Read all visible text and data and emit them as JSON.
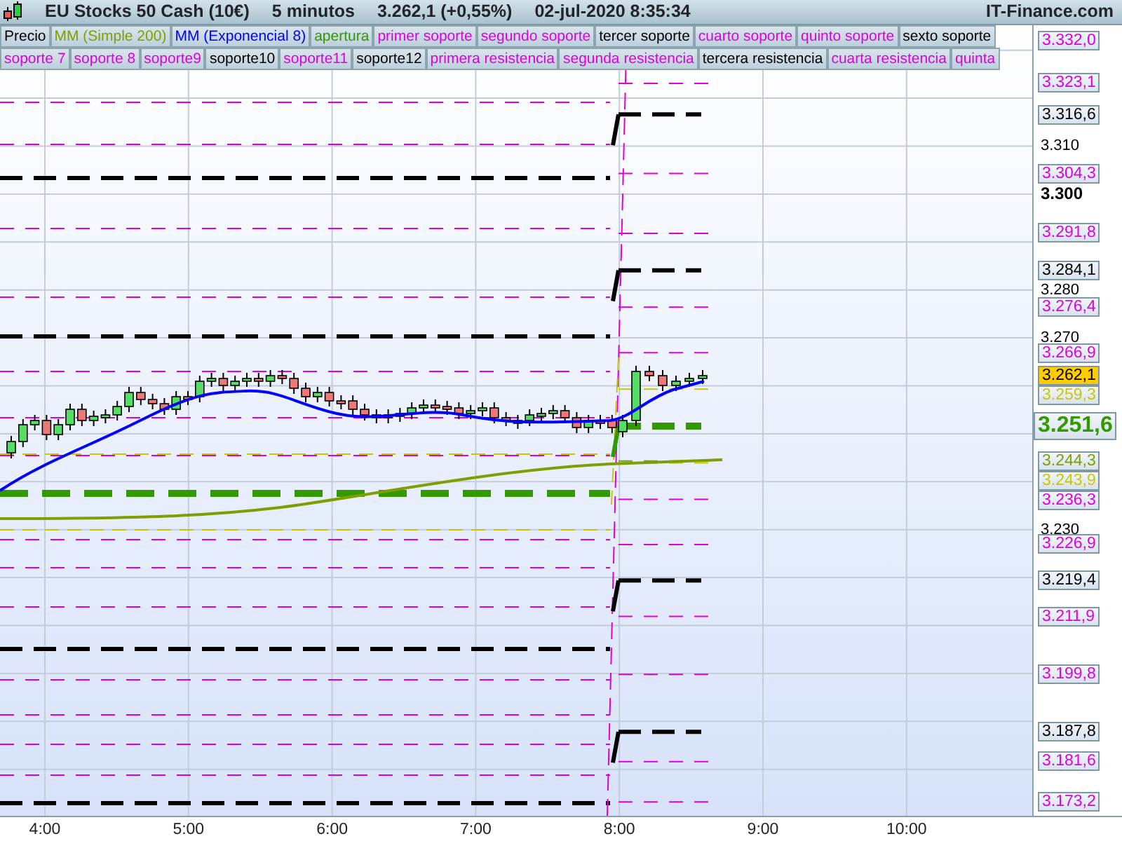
{
  "header": {
    "instrument": "EU Stocks 50 Cash (10€)",
    "timeframe": "5 minutos",
    "price": "3.262,1 (+0,55%)",
    "datetime": "02-jul-2020 8:35:34",
    "site": "IT-Finance.com"
  },
  "legend_rows": [
    {
      "items": [
        {
          "label": "Precio",
          "color": "#000000"
        },
        {
          "label": "MM (Simple 200)",
          "color": "#7f9f00"
        },
        {
          "label": "MM (Exponencial 8)",
          "color": "#0000ff"
        },
        {
          "label": "apertura",
          "color": "#339900"
        },
        {
          "label": "primer soporte",
          "color": "#dd00dd"
        },
        {
          "label": "segundo soporte",
          "color": "#dd00dd"
        },
        {
          "label": "tercer soporte",
          "color": "#000000"
        },
        {
          "label": "cuarto soporte",
          "color": "#dd00dd"
        },
        {
          "label": "quinto soporte",
          "color": "#dd00dd"
        },
        {
          "label": "sexto soporte",
          "color": "#000000"
        }
      ]
    },
    {
      "items": [
        {
          "label": "soporte 7",
          "color": "#dd00dd"
        },
        {
          "label": "soporte 8",
          "color": "#dd00dd"
        },
        {
          "label": "soporte9",
          "color": "#dd00dd"
        },
        {
          "label": "soporte10",
          "color": "#000000"
        },
        {
          "label": "soporte11",
          "color": "#dd00dd"
        },
        {
          "label": "soporte12",
          "color": "#000000"
        },
        {
          "label": "primera resistencia",
          "color": "#dd00dd"
        },
        {
          "label": "segunda resistencia",
          "color": "#dd00dd"
        },
        {
          "label": "tercera resistencia",
          "color": "#000000"
        },
        {
          "label": "cuarta resistencia",
          "color": "#dd00dd"
        },
        {
          "label": "quinta",
          "color": "#dd00dd"
        }
      ]
    }
  ],
  "price_axis": {
    "grid_labels": [
      {
        "text": "3.310",
        "major": false
      },
      {
        "text": "3.300",
        "major": true
      },
      {
        "text": "3.280",
        "major": false
      },
      {
        "text": "3.270",
        "major": false
      },
      {
        "text": "3.230",
        "major": false
      }
    ],
    "level_labels": [
      {
        "text": "3.332,0",
        "color": "#dd00dd",
        "kind": "level"
      },
      {
        "text": "3.323,1",
        "color": "#dd00dd",
        "kind": "level"
      },
      {
        "text": "3.316,6",
        "color": "#000000",
        "kind": "level"
      },
      {
        "text": "3.304,3",
        "color": "#dd00dd",
        "kind": "level"
      },
      {
        "text": "3.291,8",
        "color": "#dd00dd",
        "kind": "level"
      },
      {
        "text": "3.284,1",
        "color": "#000000",
        "kind": "level"
      },
      {
        "text": "3.276,4",
        "color": "#dd00dd",
        "kind": "level"
      },
      {
        "text": "3.266,9",
        "color": "#dd00dd",
        "kind": "level"
      },
      {
        "text": "3.262,1",
        "color": "#ffcc00",
        "kind": "current"
      },
      {
        "text": "3.259,3",
        "color": "#c8c800",
        "kind": "level"
      },
      {
        "text": "3.251,6",
        "color": "#339900",
        "kind": "open"
      },
      {
        "text": "3.244,3",
        "color": "#7f9f00",
        "kind": "level"
      },
      {
        "text": "3.243,9",
        "color": "#c8c800",
        "kind": "level"
      },
      {
        "text": "3.236,3",
        "color": "#dd00dd",
        "kind": "level"
      },
      {
        "text": "3.226,9",
        "color": "#dd00dd",
        "kind": "level"
      },
      {
        "text": "3.219,4",
        "color": "#000000",
        "kind": "level"
      },
      {
        "text": "3.211,9",
        "color": "#dd00dd",
        "kind": "level"
      },
      {
        "text": "3.199,8",
        "color": "#dd00dd",
        "kind": "level"
      },
      {
        "text": "3.187,8",
        "color": "#000000",
        "kind": "level"
      },
      {
        "text": "3.181,6",
        "color": "#dd00dd",
        "kind": "level"
      },
      {
        "text": "3.173,2",
        "color": "#dd00dd",
        "kind": "level"
      }
    ]
  },
  "time_axis": {
    "labels": [
      "4:00",
      "5:00",
      "6:00",
      "7:00",
      "8:00",
      "9:00",
      "10:00"
    ]
  }
}
